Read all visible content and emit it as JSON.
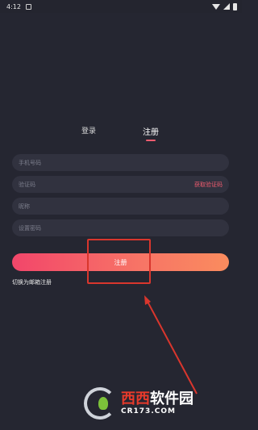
{
  "status_bar": {
    "time": "4:12"
  },
  "tabs": {
    "login": "登录",
    "register": "注册",
    "active": "register"
  },
  "form": {
    "phone_placeholder": "手机号码",
    "code_placeholder": "验证码",
    "get_code_label": "获取验证码",
    "nickname_placeholder": "昵称",
    "password_placeholder": "设置密码"
  },
  "register_button_label": "注册",
  "switch_email_label": "切换为邮箱注册",
  "colors": {
    "background": "#252631",
    "field": "#31323f",
    "accent": "#f25c6f",
    "button_gradient_start": "#f2466a",
    "button_gradient_end": "#fa8c5e",
    "annotation": "#d9362d"
  },
  "watermark": {
    "main_red": "西西",
    "main_white": "软件园",
    "sub": "CR173.COM"
  }
}
